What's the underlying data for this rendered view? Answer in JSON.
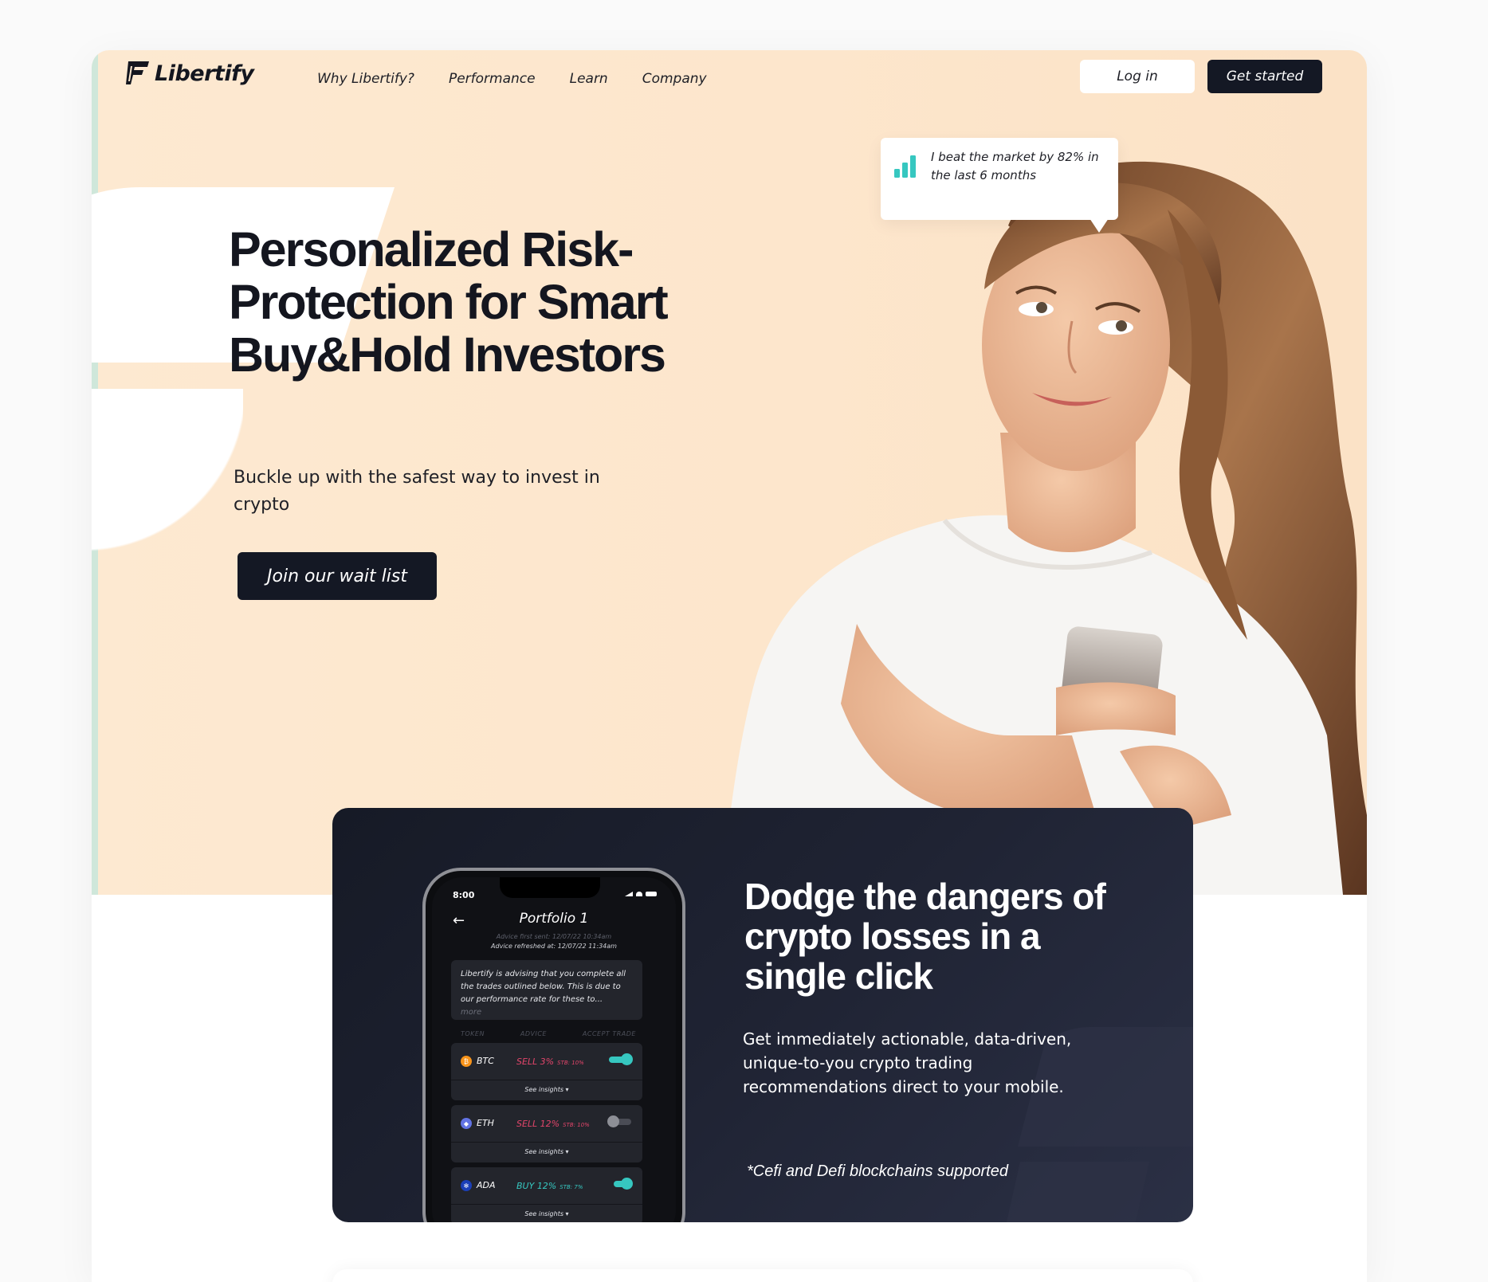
{
  "brand": {
    "name": "Libertify"
  },
  "nav": {
    "items": [
      {
        "label": "Why Libertify?"
      },
      {
        "label": "Performance"
      },
      {
        "label": "Learn"
      },
      {
        "label": "Company"
      }
    ],
    "login_label": "Log in",
    "get_started_label": "Get started"
  },
  "hero": {
    "title": "Personalized Risk-Protection for Smart Buy&Hold Investors",
    "subtitle": "Buckle up with the safest way to invest in crypto",
    "cta_label": "Join our wait list",
    "bubble_text": "I beat the market by 82% in the last 6 months"
  },
  "feature": {
    "title": "Dodge the dangers of crypto losses in a single click",
    "subtitle": "Get immediately actionable, data-driven, unique-to-you crypto trading recommendations direct to your mobile.",
    "note": "*Cefi and Defi blockchains supported"
  },
  "phone": {
    "time": "8:00",
    "title": "Portfolio 1",
    "meta_sent": "Advice first sent: 12/07/22  10:34am",
    "meta_refreshed": "Advice refreshed at: 12/07/22  11:34am",
    "advice_text": "Libertify is advising that you complete all the trades outlined below. This is due to our performance rate for these to...",
    "advice_more": "more",
    "columns": {
      "token": "TOKEN",
      "advice": "ADVICE",
      "accept": "ACCEPT TRADE"
    },
    "rows": [
      {
        "token": "BTC",
        "advice": "SELL 3%",
        "stb": "STB: 10%",
        "insights": "See insights ▾",
        "accepted": true,
        "coin_color": "#f7931a",
        "advice_color": "#e2456a",
        "coin_glyph": "₿"
      },
      {
        "token": "ETH",
        "advice": "SELL 12%",
        "stb": "STB: 10%",
        "insights": "See insights ▾",
        "accepted": false,
        "coin_color": "#6273e4",
        "advice_color": "#e2456a",
        "coin_glyph": "◆"
      },
      {
        "token": "ADA",
        "advice": "BUY 12%",
        "stb": "STB: 7%",
        "insights": "See insights ▾",
        "accepted": true,
        "coin_color": "#1b3fb8",
        "advice_color": "#36c7c0",
        "coin_glyph": "✻"
      }
    ]
  },
  "colors": {
    "dark": "#141824",
    "teal": "#36c7c0",
    "peach": "#fde6cc"
  }
}
